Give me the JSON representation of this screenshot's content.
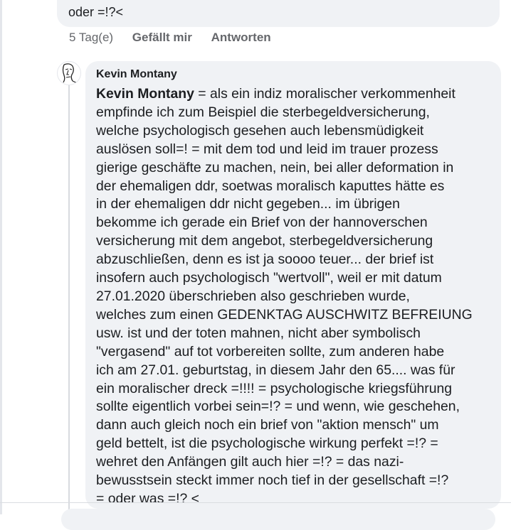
{
  "previous_comment": {
    "text_tail": "oder =!?<",
    "actions": {
      "time": "5 Tag(e)",
      "like": "Gefällt mir",
      "reply": "Antworten"
    }
  },
  "comment": {
    "author": "Kevin Montany",
    "inline_name": "Kevin Montany",
    "lines": [
      " = als ein indiz moralischer verkommenheit",
      "empfinde ich zum Beispiel die sterbegeldversicherung,",
      "welche psychologisch gesehen auch lebensmüdigkeit",
      "auslösen soll=! = mit dem tod und leid im trauer prozess",
      "gierige geschäfte zu machen, nein, bei aller deformation in",
      "der ehemaligen ddr, soetwas  moralisch kaputtes hätte es",
      "in der ehemaligen ddr nicht gegeben... im übrigen",
      "bekomme ich gerade ein Brief von der hannoverschen",
      "versicherung mit dem angebot, sterbegeldversicherung",
      "abzuschließen, denn es ist ja soooo teuer... der brief ist",
      "insofern auch psychologisch \"wertvoll\", weil er mit datum",
      "27.01.2020 überschrieben also geschrieben wurde,",
      "welches zum einen GEDENKTAG AUSCHWITZ BEFREIUNG",
      "usw. ist und der toten mahnen, nicht aber symbolisch",
      "\"vergasend\" auf tot vorbereiten sollte, zum anderen habe",
      "ich am 27.01. geburtstag, in diesem Jahr den 65.... was für",
      "ein moralischer dreck =!!!! = psychologische kriegsführung",
      "sollte eigentlich vorbei sein=!? = und wenn, wie geschehen,",
      "dann auch gleich noch ein brief von \"aktion mensch\" um",
      "geld bettelt, ist die psychologische wirkung perfekt =!? =",
      "wehret den Anfängen gilt auch hier =!? = das nazi-",
      "bewusstsein steckt immer noch tief in der gesellschaft =!?",
      "= oder was =!? <"
    ]
  },
  "icons": {
    "avatar": "line-drawing-face-avatar"
  }
}
